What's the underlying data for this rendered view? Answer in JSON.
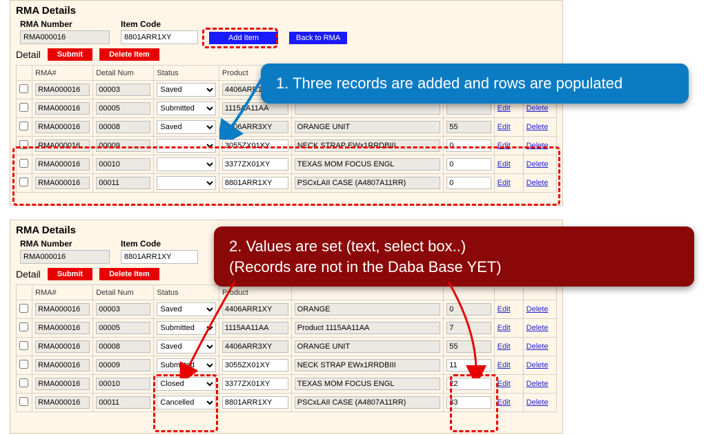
{
  "colors": {
    "accent_red": "#e80000",
    "accent_blue": "#1a1aff",
    "callout_blue": "#0b7cc4",
    "callout_red": "#8b0808",
    "link": "#2020d0",
    "beige": "#fff6e8"
  },
  "header": {
    "title": "RMA Details",
    "rma_number_label": "RMA Number",
    "rma_number_value": "RMA000016",
    "item_code_label": "Item Code",
    "item_code_value": "8801ARR1XY",
    "add_item": "Add Item",
    "back_to_rma": "Back to RMA"
  },
  "detail_bar": {
    "label": "Detail",
    "submit": "Submit",
    "delete_item": "Delete Item"
  },
  "grid": {
    "headers": {
      "rma": "RMA#",
      "detail_num": "Detail Num",
      "status": "Status",
      "product": "Product",
      "qty": "",
      "edit": "",
      "delete": ""
    },
    "links": {
      "edit": "Edit",
      "delete": "Delete"
    }
  },
  "panel1_rows": [
    {
      "rma": "RMA000016",
      "det": "00003",
      "status": "Saved",
      "prod": "4406ARR1XY",
      "desc": "",
      "qty": "",
      "white": false
    },
    {
      "rma": "RMA000016",
      "det": "00005",
      "status": "Submitted",
      "prod": "1115AA11AA",
      "desc": "",
      "qty": "",
      "white": false
    },
    {
      "rma": "RMA000016",
      "det": "00008",
      "status": "Saved",
      "prod": "4406ARR3XY",
      "desc": "ORANGE UNIT",
      "qty": "55",
      "white": false
    },
    {
      "rma": "RMA000016",
      "det": "00009",
      "status": "",
      "prod": "3055ZX01XY",
      "desc": "NECK STRAP EWx1RRDBIII",
      "qty": "0",
      "white": true
    },
    {
      "rma": "RMA000016",
      "det": "00010",
      "status": "",
      "prod": "3377ZX01XY",
      "desc": "TEXAS MOM FOCUS ENGL",
      "qty": "0",
      "white": true
    },
    {
      "rma": "RMA000016",
      "det": "00011",
      "status": "",
      "prod": "8801ARR1XY",
      "desc": "PSCxLAII CASE (A4807A11RR)",
      "qty": "0",
      "white": true
    }
  ],
  "panel2_rows": [
    {
      "rma": "RMA000016",
      "det": "00003",
      "status": "Saved",
      "prod": "4406ARR1XY",
      "desc": "ORANGE",
      "qty": "0",
      "white": false
    },
    {
      "rma": "RMA000016",
      "det": "00005",
      "status": "Submitted",
      "prod": "1115AA11AA",
      "desc": "Product 1115AA11AA",
      "qty": "7",
      "white": false
    },
    {
      "rma": "RMA000016",
      "det": "00008",
      "status": "Saved",
      "prod": "4406ARR3XY",
      "desc": "ORANGE UNIT",
      "qty": "55",
      "white": false
    },
    {
      "rma": "RMA000016",
      "det": "00009",
      "status": "Submitted",
      "prod": "3055ZX01XY",
      "desc": "NECK STRAP EWx1RRDBIII",
      "qty": "11",
      "white": true
    },
    {
      "rma": "RMA000016",
      "det": "00010",
      "status": "Closed",
      "prod": "3377ZX01XY",
      "desc": "TEXAS MOM FOCUS ENGL",
      "qty": "22",
      "white": true
    },
    {
      "rma": "RMA000016",
      "det": "00011",
      "status": "Cancelled",
      "prod": "8801ARR1XY",
      "desc": "PSCxLAII CASE (A4807A11RR)",
      "qty": "33",
      "white": true
    }
  ],
  "annotations": {
    "callout1": "1. Three records are added and rows are populated",
    "callout2_line1": "2. Values are set (text, select box..)",
    "callout2_line2": "(Records are not in the Daba Base YET)"
  }
}
